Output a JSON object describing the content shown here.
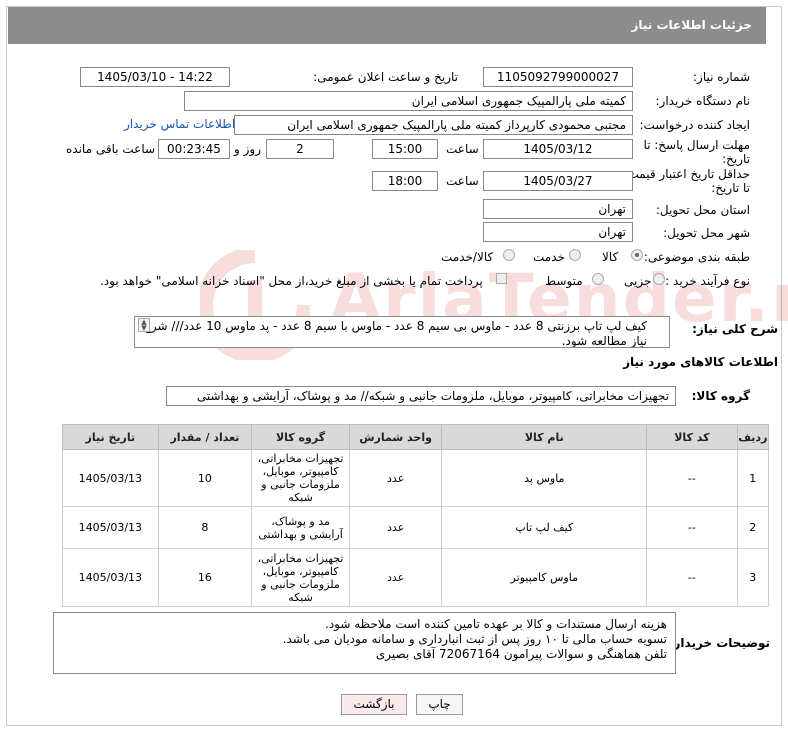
{
  "header": {
    "title": "جزئیات اطلاعات نیاز"
  },
  "fields": {
    "need_number_label": "شماره نیاز:",
    "need_number": "1105092799000027",
    "announce_label": "تاریخ و ساعت اعلان عمومی:",
    "announce_value": "1405/03/10 - 14:22",
    "buyer_label": "نام دستگاه خریدار:",
    "buyer_value": "کمیته ملی پارالمپیک جمهوری اسلامی ایران",
    "creator_label": "ایجاد کننده درخواست:",
    "creator_value": "مجتبی محمودی کارپرداز کمیته ملی پارالمپیک جمهوری اسلامی ایران",
    "contact_link": "اطلاعات تماس خریدار",
    "deadline_label": "مهلت ارسال پاسخ: تا تاریخ:",
    "deadline_date": "1405/03/12",
    "hour_label": "ساعت",
    "deadline_time": "15:00",
    "days_value": "2",
    "days_label": "روز و",
    "remaining_value": "00:23:45",
    "remaining_label": "ساعت باقی مانده",
    "min_price_label": "حداقل تاریخ اعتبار قیمت: تا تاریخ:",
    "min_price_date": "1405/03/27",
    "min_price_time": "18:00",
    "province_label": "استان محل تحویل:",
    "province_value": "تهران",
    "city_label": "شهر محل تحویل:",
    "city_value": "تهران",
    "category_label": "طبقه بندی موضوعی:",
    "category_options": [
      "کالا",
      "خدمت",
      "کالا/خدمت"
    ],
    "process_label": "نوع فرآیند خرید :",
    "process_options": [
      "جزیی",
      "متوسط"
    ],
    "payment_note": "پرداخت تمام یا بخشی از مبلغ خرید،از محل \"اسناد خزانه اسلامی\" خواهد بود."
  },
  "description": {
    "label": "شرح کلی نیاز:",
    "text": "کیف لپ تاپ برزنتی 8 عدد - ماوس بی سیم 8 عدد - ماوس با سیم 8 عدد - پد ماوس 10 عدد/// شرح نیاز مطالعه شود."
  },
  "goods_info": {
    "section_title": "اطلاعات کالاهای مورد نیاز",
    "group_label": "گروه کالا:",
    "group_value": "تجهیزات مخابراتی، کامپیوتر، موبایل، ملزومات جانبی و شبکه// مد و پوشاک، آرایشی و بهداشتی"
  },
  "table": {
    "headers": [
      "ردیف",
      "کد کالا",
      "نام کالا",
      "واحد شمارش",
      "گروه کالا",
      "تعداد / مقدار",
      "تاریخ نیاز"
    ],
    "rows": [
      {
        "row": "1",
        "code": "--",
        "name": "ماوس پد",
        "unit": "عدد",
        "group": "تجهیزات مخابراتی، کامپیوتر، موبایل، ملزومات جانبی و شبکه",
        "qty": "10",
        "date": "1405/03/13"
      },
      {
        "row": "2",
        "code": "--",
        "name": "کیف لپ تاپ",
        "unit": "عدد",
        "group": "مد و پوشاک، آرایشی و بهداشتی",
        "qty": "8",
        "date": "1405/03/13"
      },
      {
        "row": "3",
        "code": "--",
        "name": "ماوس کامپیوتر",
        "unit": "عدد",
        "group": "تجهیزات مخابراتی، کامپیوتر، موبایل، ملزومات جانبی و شبکه",
        "qty": "16",
        "date": "1405/03/13"
      }
    ]
  },
  "notes": {
    "label": "توضیحات خریدار:",
    "lines": [
      "هزینه ارسال مستندات و کالا بر عهده تامین کننده است ملاحظه شود.",
      "تسویه حساب مالی تا ۱۰ روز پس از ثبت انبارداری و سامانه مودیان می باشد.",
      "تلفن هماهنگی و سوالات پیرامون 72067164 آقای بصیری"
    ]
  },
  "buttons": {
    "print": "چاپ",
    "back": "بازگشت"
  },
  "watermark": {
    "text": "AriaTender.neT",
    "logo": "aria-tender-logo"
  }
}
